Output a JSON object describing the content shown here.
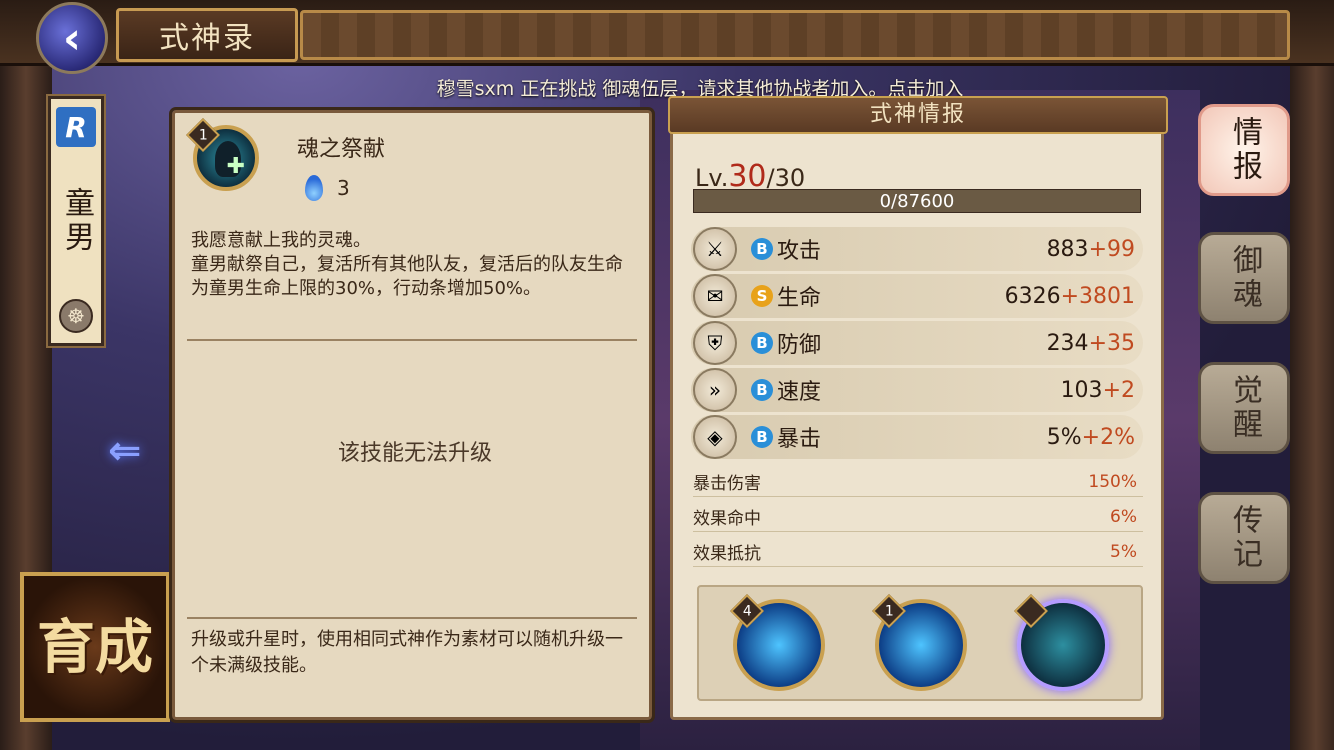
{
  "header": {
    "title": "式神录",
    "back_icon": "back-arrow-icon"
  },
  "notice": "穆雪sxm 正在挑战 御魂伍层，请求其他协战者加入。点击加入",
  "shikigami": {
    "rarity": "R",
    "name": "童男"
  },
  "nurture_label": "育成",
  "skill": {
    "level": "1",
    "name": "魂之祭献",
    "cost": "3",
    "desc": "我愿意献上我的灵魂。\n童男献祭自己，复活所有其他队友，复活后的队友生命为童男生命上限的30%，行动条增加50%。",
    "no_upgrade": "该技能无法升级",
    "footer": "升级或升星时，使用相同式神作为素材可以随机升级一个未满级技能。"
  },
  "info": {
    "header": "式神情报",
    "lv_label": "Lv.",
    "lv_cur": "30",
    "lv_max": "/30",
    "exp": "0/87600",
    "stats": [
      {
        "grade": "B",
        "grade_color": "#2a8fd8",
        "name": "攻击",
        "base": "883",
        "add": "+99"
      },
      {
        "grade": "S",
        "grade_color": "#e8a21a",
        "name": "生命",
        "base": "6326",
        "add": "+3801"
      },
      {
        "grade": "B",
        "grade_color": "#2a8fd8",
        "name": "防御",
        "base": "234",
        "add": "+35"
      },
      {
        "grade": "B",
        "grade_color": "#2a8fd8",
        "name": "速度",
        "base": "103",
        "add": "+2"
      },
      {
        "grade": "B",
        "grade_color": "#2a8fd8",
        "name": "暴击",
        "base": "5%",
        "add": "+2%"
      }
    ],
    "sub_stats": [
      {
        "name": "暴击伤害",
        "value": "150%"
      },
      {
        "name": "效果命中",
        "value": "6%"
      },
      {
        "name": "效果抵抗",
        "value": "5%"
      }
    ],
    "skill_levels": [
      "4",
      "1",
      ""
    ]
  },
  "tabs": [
    "情报",
    "御魂",
    "觉醒",
    "传记"
  ]
}
